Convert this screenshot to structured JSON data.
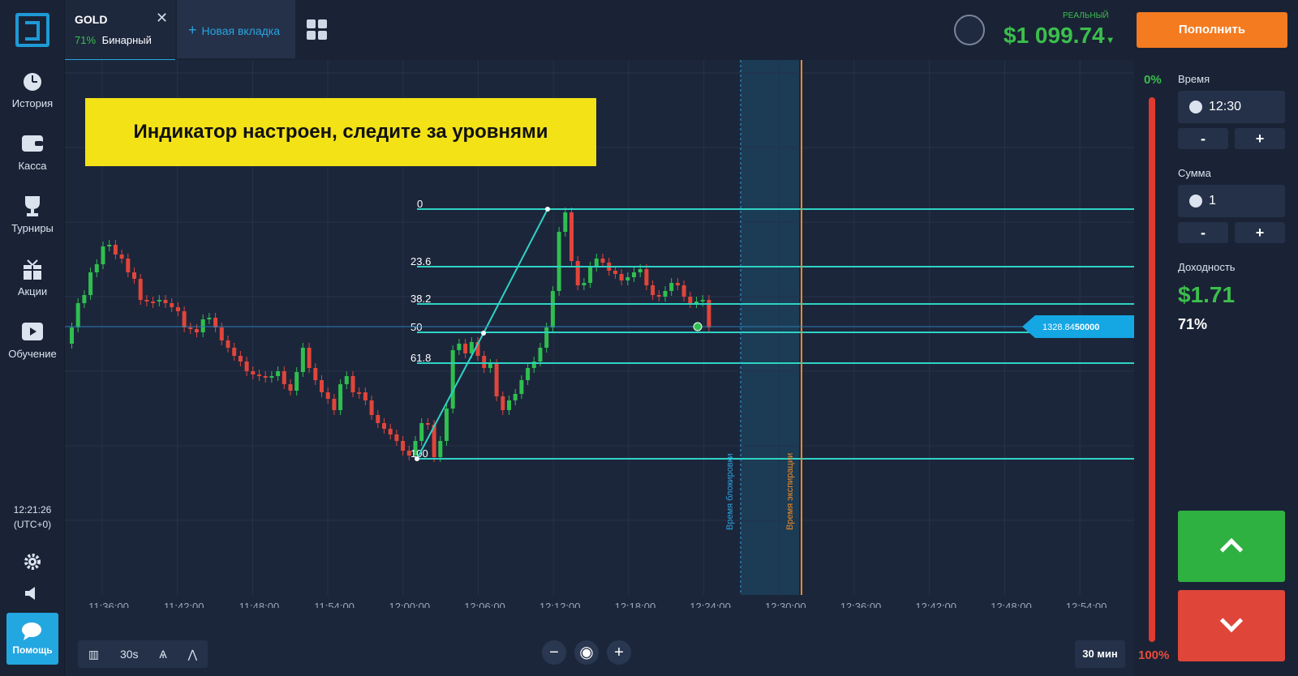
{
  "sidebar": {
    "items": [
      {
        "label": "История",
        "icon": "history-icon"
      },
      {
        "label": "Касса",
        "icon": "wallet-icon"
      },
      {
        "label": "Турниры",
        "icon": "trophy-icon"
      },
      {
        "label": "Акции",
        "icon": "gift-icon"
      },
      {
        "label": "Обучение",
        "icon": "play-icon"
      }
    ],
    "clock_time": "12:21:26",
    "clock_tz": "(UTC+0)",
    "help_label": "Помощь"
  },
  "topbar": {
    "asset_name": "GOLD",
    "asset_pct": "71%",
    "asset_type": "Бинарный",
    "new_tab_label": "Новая вкладка",
    "account_type": "РЕАЛЬНЫЙ",
    "balance": "$1 099.74",
    "deposit_label": "Пополнить"
  },
  "chart": {
    "banner": "Индикатор настроен, следите за уровнями",
    "fib_levels": [
      "0",
      "23.6",
      "38.2",
      "50",
      "61.8",
      "100"
    ],
    "price_tag_main": "1328.84",
    "price_tag_tail": "50000",
    "lock_label": "Время блокировки",
    "expiry_label": "Время экспирации",
    "x_ticks": [
      "11:36:00",
      "11:42:00",
      "11:48:00",
      "11:54:00",
      "12:00:00",
      "12:06:00",
      "12:12:00",
      "12:18:00",
      "12:24:00",
      "12:30:00",
      "12:36:00",
      "12:42:00",
      "12:48:00",
      "12:54:00"
    ],
    "colors": {
      "up": "#2fbf4f",
      "down": "#e0453a",
      "fib": "#2ed3c4",
      "expiry": "#f08a24",
      "lock": "#2aa3e0"
    }
  },
  "bottombar": {
    "timeframe": "30s",
    "zoom_out": "−",
    "zoom_in": "+",
    "period": "30 мин"
  },
  "panel": {
    "pct_top": "0%",
    "pct_bottom": "100%",
    "time_label": "Время",
    "time_value": "12:30",
    "amount_label": "Сумма",
    "amount_value": "1",
    "minus": "-",
    "plus": "+",
    "yield_label": "Доходность",
    "profit": "$1.71",
    "profit_pct": "71%"
  }
}
